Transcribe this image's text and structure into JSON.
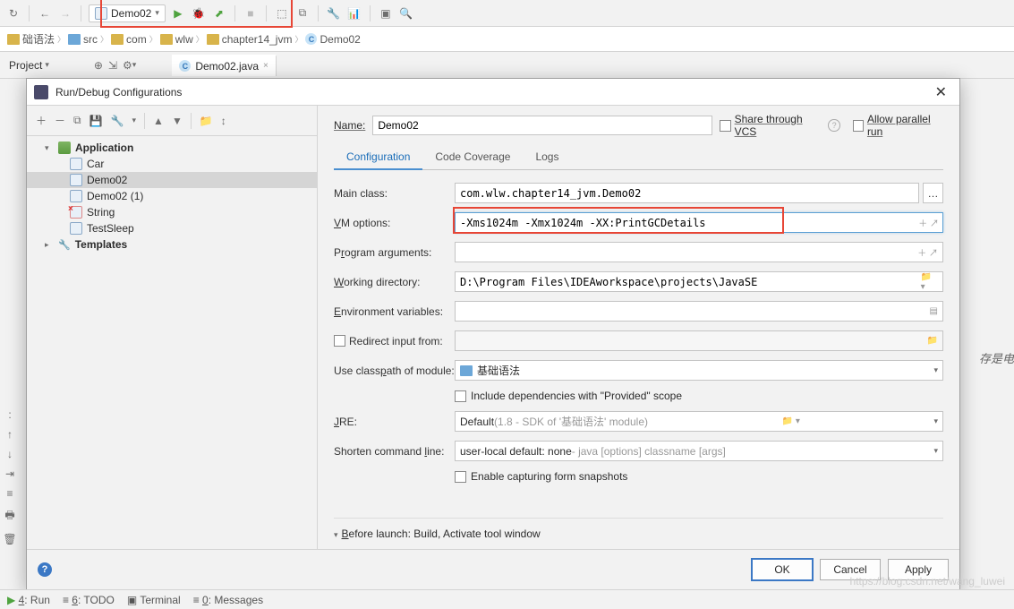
{
  "toolbar": {
    "run_config": "Demo02"
  },
  "breadcrumbs": {
    "root": "础语法",
    "items": [
      "src",
      "com",
      "wlw",
      "chapter14_jvm"
    ],
    "file": "Demo02"
  },
  "third_row": {
    "project_btn": "Project",
    "open_file_tab": "Demo02.java"
  },
  "dialog": {
    "title": "Run/Debug Configurations",
    "tree": {
      "group": "Application",
      "items": [
        {
          "label": "Car",
          "sel": false
        },
        {
          "label": "Demo02",
          "sel": true
        },
        {
          "label": "Demo02 (1)",
          "sel": false
        },
        {
          "label": "String",
          "sel": false,
          "err": true
        },
        {
          "label": "TestSleep",
          "sel": false
        }
      ],
      "templates": "Templates"
    },
    "name_label": "Name:",
    "name_value": "Demo02",
    "share_label": "Share through VCS",
    "allow_parallel": "Allow parallel run",
    "tabs": [
      "Configuration",
      "Code Coverage",
      "Logs"
    ],
    "fields": {
      "main_class_lbl": "Main class:",
      "main_class_val": "com.wlw.chapter14_jvm.Demo02",
      "vm_lbl": "VM options:",
      "vm_val": "-Xms1024m -Xmx1024m -XX:PrintGCDetails",
      "prog_args_lbl": "Program arguments:",
      "workdir_lbl": "Working directory:",
      "workdir_val": "D:\\Program Files\\IDEAworkspace\\projects\\JavaSE",
      "env_lbl": "Environment variables:",
      "redirect_lbl": "Redirect input from:",
      "classpath_lbl": "Use classpath of module:",
      "classpath_val": "基础语法",
      "include_deps": "Include dependencies with \"Provided\" scope",
      "jre_lbl": "JRE:",
      "jre_val": "Default",
      "jre_hint": " (1.8 - SDK of '基础语法' module)",
      "shorten_lbl": "Shorten command line:",
      "shorten_val": "user-local default: none",
      "shorten_hint": " - java [options] classname [args]",
      "enable_snapshots": "Enable capturing form snapshots"
    },
    "before_launch": "Before launch: Build, Activate tool window",
    "buttons": {
      "ok": "OK",
      "cancel": "Cancel",
      "apply": "Apply"
    }
  },
  "bottom_bar": {
    "run": "4: Run",
    "todo": "6: TODO",
    "terminal": "Terminal",
    "messages": "0: Messages"
  },
  "side_text": "存是电",
  "watermark": "https://blog.csdn.net/wang_luwei"
}
